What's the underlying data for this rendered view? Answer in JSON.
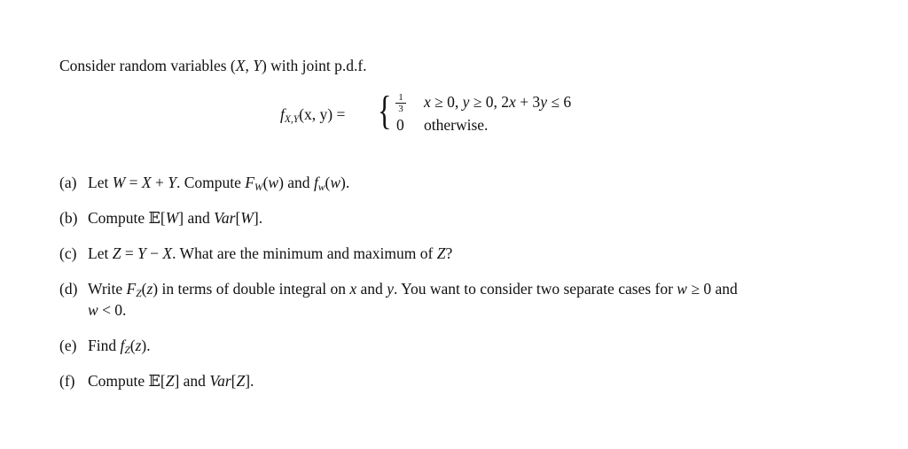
{
  "intro": "Consider random variables (X, Y) with joint p.d.f.",
  "formula": {
    "lhs_func": "f",
    "lhs_sub": "X,Y",
    "lhs_args": "(x, y) =",
    "case1_value_num": "1",
    "case1_value_den": "3",
    "case1_condition": "x ≥ 0, y ≥ 0, 2x + 3y ≤ 6",
    "case2_value": "0",
    "case2_condition": "otherwise."
  },
  "parts": [
    {
      "label": "(a)",
      "text_html": "Let <i>W</i> = <i>X</i> + <i>Y</i>. Compute <i>F</i><span class=\"sub\">W</span>(<i>w</i>) and <i>f</i><span class=\"sub\">w</span>(<i>w</i>)."
    },
    {
      "label": "(b)",
      "text_html": "Compute <span class=\"bb\">𝔼</span>[<i>W</i>] and <i>Var</i>[<i>W</i>]."
    },
    {
      "label": "(c)",
      "text_html": "Let <i>Z</i> = <i>Y</i> − <i>X</i>. What are the minimum and maximum of <i>Z</i>?"
    },
    {
      "label": "(d)",
      "text_html": "Write <i>F</i><span class=\"sub\">Z</span>(<i>z</i>) in terms of double integral on <i>x</i> and <i>y</i>. You want to consider two separate cases for <i>w</i> ≥ 0 and",
      "continuation_html": "<i>w</i> &lt; 0."
    },
    {
      "label": "(e)",
      "text_html": "Find <i>f</i><span class=\"sub\">Z</span>(<i>z</i>)."
    },
    {
      "label": "(f)",
      "text_html": "Compute <span class=\"bb\">𝔼</span>[<i>Z</i>] and <i>Var</i>[<i>Z</i>]."
    }
  ]
}
